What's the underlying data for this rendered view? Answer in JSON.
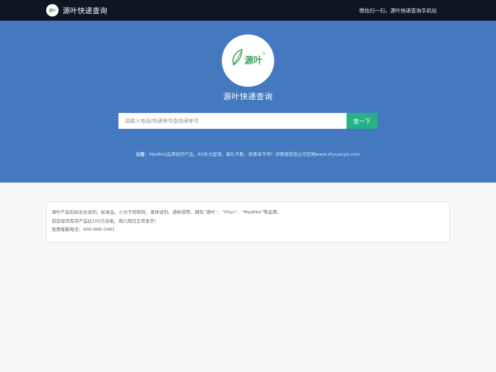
{
  "header": {
    "logo_text": "源叶",
    "title": "源叶快递查询",
    "right_text": "微信扫一扫，源叶快递查询手机站"
  },
  "hero": {
    "logo_text": "源叶",
    "title": "源叶快递查询",
    "search": {
      "placeholder": "请输入电话/快递单号查快递单号",
      "value": "",
      "button_label": "查一下"
    },
    "notice": {
      "label": "公告",
      "text": "：MedMol品牌现货产品，85折大促销，豪礼不断，惊喜享不停！详情请登陆公司官网www.shyuanye.com"
    }
  },
  "info": {
    "lines": [
      "源叶产品包括生化试剂、标准品、小分子抑制剂、液体试剂、透析袋等，拥有“源叶”、“Fifan”、“MedMol”等品牌。",
      "目前现货库存产品达100万余瓶，周六周日正常发货！",
      "免费客服电话：400-666-5481"
    ]
  },
  "colors": {
    "topbar": "#0f1623",
    "hero": "#4479bf",
    "button": "#27b187",
    "logo_green": "#3aa35a"
  },
  "icons": {
    "brand_logo": "leaf-logo-icon",
    "hero_logo": "leaf-logo-icon"
  }
}
